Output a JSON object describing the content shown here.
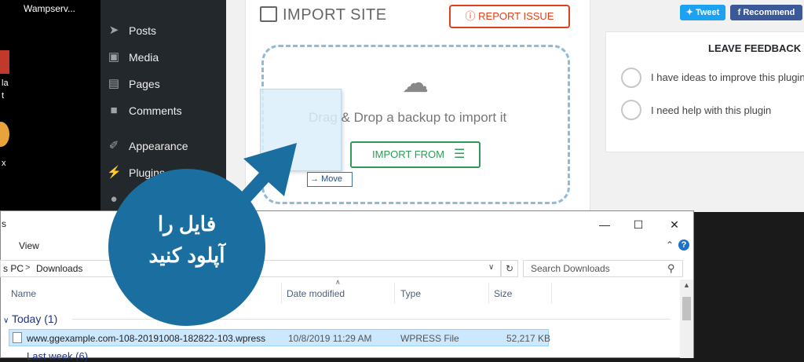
{
  "desktop": {
    "title": "Wampserv...",
    "labels": [
      "la",
      "t",
      "x"
    ]
  },
  "wp_menu": {
    "items": [
      {
        "label": "Posts",
        "icon": "pushpin-icon"
      },
      {
        "label": "Media",
        "icon": "media-icon"
      },
      {
        "label": "Pages",
        "icon": "pages-icon"
      },
      {
        "label": "Comments",
        "icon": "comments-icon"
      },
      {
        "label": "Appearance",
        "icon": "paintbrush-icon"
      },
      {
        "label": "Plugins",
        "icon": "plugin-icon"
      }
    ]
  },
  "import": {
    "title": "IMPORT SITE",
    "report_label": "REPORT ISSUE",
    "drag_text": "Drag & Drop a backup to import it",
    "import_from_label": "IMPORT FROM",
    "move_label": "Move"
  },
  "social": {
    "tweet_label": "Tweet",
    "recommend_label": "Recommend"
  },
  "feedback": {
    "title": "LEAVE FEEDBACK",
    "options": [
      "I have ideas to improve this plugin",
      "I need help with this plugin"
    ]
  },
  "explorer": {
    "view_label": "View",
    "address": {
      "pc": "s PC",
      "separator": ">",
      "folder": "Downloads"
    },
    "search_placeholder": "Search Downloads",
    "columns": [
      "Name",
      "Date modified",
      "Type",
      "Size"
    ],
    "group_label": "Today (1)",
    "group2_label": "Last week (6)",
    "file": {
      "name": "www.ggexample.com-108-20191008-182822-103.wpress",
      "date": "10/8/2019 11:29 AM",
      "type": "WPRESS File",
      "size": "52,217 KB"
    },
    "nav_label": "s"
  },
  "callout": {
    "line1": "فایل را",
    "line2": "آپلود کنید"
  },
  "colors": {
    "accent_green": "#2e9a58",
    "report_red": "#e2401c",
    "callout_blue": "#1a6ea0",
    "dashed_border": "#8fbbd9"
  }
}
